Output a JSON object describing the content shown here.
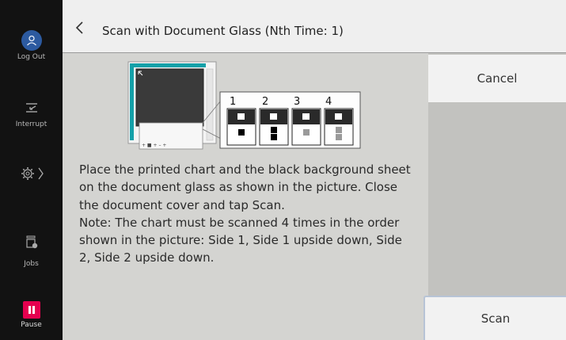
{
  "sidebar": {
    "logout_label": "Log Out",
    "interrupt_label": "Interrupt",
    "jobs_label": "Jobs",
    "pause_label": "Pause"
  },
  "header": {
    "title": "Scan with Document Glass (Nth Time: 1)"
  },
  "illustration": {
    "sequence_numbers": [
      "1",
      "2",
      "3",
      "4"
    ]
  },
  "instructions": {
    "text": "Place the printed chart and the black background sheet on the document glass as shown in the picture. Close the document cover and tap Scan.\nNote: The chart must be scanned 4 times in the order shown in the picture: Side 1, Side 1 upside down, Side 2, Side 2 upside down."
  },
  "actions": {
    "cancel_label": "Cancel",
    "scan_label": "Scan"
  },
  "colors": {
    "accent_pause": "#e5004f",
    "avatar_blue": "#2c5aa0",
    "glass_teal": "#14a0a8"
  }
}
